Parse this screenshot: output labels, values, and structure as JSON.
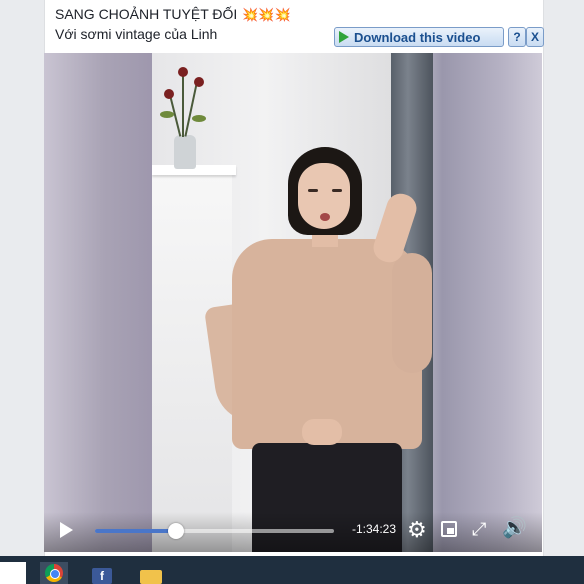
{
  "post": {
    "title": "SANG CHOẢNH TUYỆT ĐỐI",
    "title_emoji": "💥💥💥",
    "subtitle": "Với sơmi vintage của Linh"
  },
  "download_bar": {
    "button_label": "Download this video",
    "help_label": "?",
    "close_label": "X"
  },
  "player": {
    "time_remaining": "-1:34:23",
    "progress_fraction": 0.34,
    "accent_color": "#4a76c9"
  },
  "taskbar": {
    "items": [
      "chrome-icon",
      "facebook-icon",
      "folder-icon"
    ],
    "facebook_letter": "f"
  }
}
